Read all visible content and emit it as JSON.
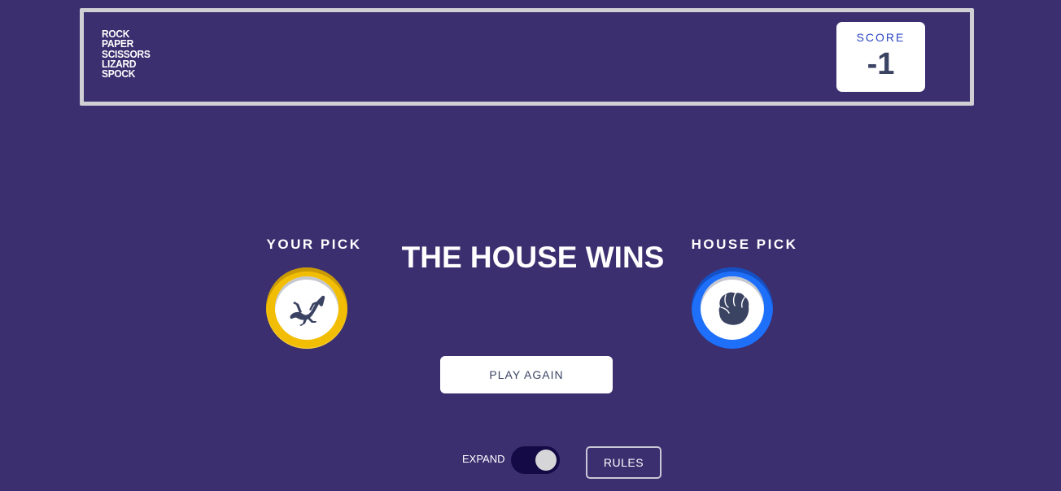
{
  "header": {
    "logo_lines": [
      "ROCK",
      "PAPER",
      "SCISSORS",
      "LIZARD",
      "SPOCK"
    ],
    "score_label": "SCORE",
    "score_value": "-1"
  },
  "game": {
    "your_pick_label": "YOUR PICK",
    "house_pick_label": "HOUSE PICK",
    "result_text": "THE HOUSE WINS",
    "your_pick": {
      "choice": "lizard",
      "icon": "lizard-icon",
      "ring_color": "#f2be05"
    },
    "house_pick": {
      "choice": "rock",
      "icon": "rock-icon",
      "ring_color": "#1e6ffa"
    },
    "play_again_label": "PLAY AGAIN"
  },
  "footer": {
    "expand_label": "EXPAND",
    "expand_toggle_on": true,
    "rules_label": "RULES"
  },
  "colors": {
    "background": "#3b2f6f",
    "icon_fill": "#3b4363"
  }
}
